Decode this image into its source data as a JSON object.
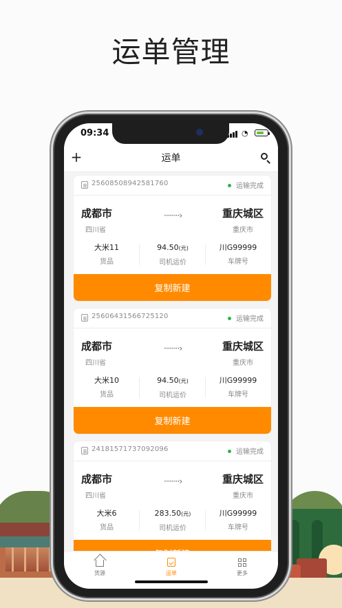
{
  "hero": {
    "title": "运单管理"
  },
  "status_bar": {
    "time": "09:34"
  },
  "nav": {
    "title": "运单"
  },
  "orders": [
    {
      "order_no": "25608508942581760",
      "status": "运输完成",
      "from_city": "成都市",
      "from_province": "四川省",
      "to_city": "重庆城区",
      "to_sub": "重庆市",
      "arrow": "········›",
      "goods": "大米11",
      "goods_label": "货品",
      "price": "94.50",
      "price_unit": "(元)",
      "price_label": "司机运价",
      "plate": "川G99999",
      "plate_label": "车牌号",
      "button": "复制新建"
    },
    {
      "order_no": "25606431566725120",
      "status": "运输完成",
      "from_city": "成都市",
      "from_province": "四川省",
      "to_city": "重庆城区",
      "to_sub": "重庆市",
      "arrow": "········›",
      "goods": "大米10",
      "goods_label": "货品",
      "price": "94.50",
      "price_unit": "(元)",
      "price_label": "司机运价",
      "plate": "川G99999",
      "plate_label": "车牌号",
      "button": "复制新建"
    },
    {
      "order_no": "24181571737092096",
      "status": "运输完成",
      "from_city": "成都市",
      "from_province": "四川省",
      "to_city": "重庆城区",
      "to_sub": "重庆市",
      "arrow": "········›",
      "goods": "大米6",
      "goods_label": "货品",
      "price": "283.50",
      "price_unit": "(元)",
      "price_label": "司机运价",
      "plate": "川G99999",
      "plate_label": "车牌号",
      "button": "复制新建"
    }
  ],
  "tabbar": {
    "items": [
      {
        "label": "货源"
      },
      {
        "label": "运单"
      },
      {
        "label": "更多"
      }
    ]
  },
  "colors": {
    "accent": "#ff8a00",
    "success": "#2db24a"
  }
}
